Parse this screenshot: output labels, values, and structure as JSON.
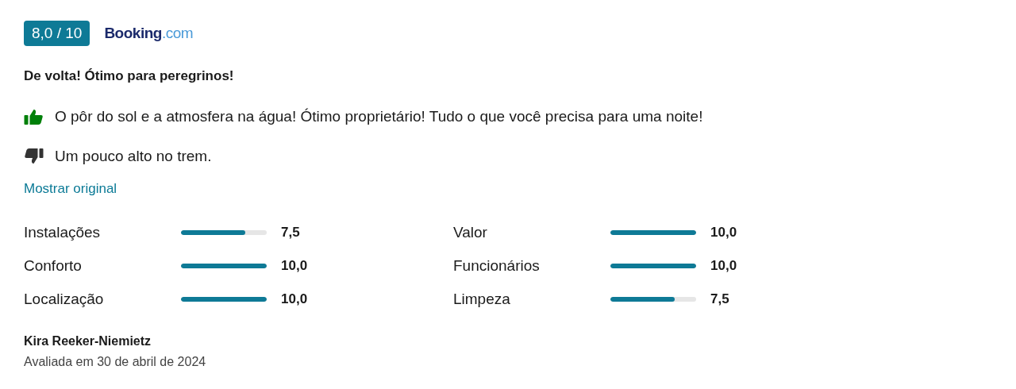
{
  "score": "8,0 / 10",
  "source": "Booking.com",
  "title": "De volta! Ótimo para peregrinos!",
  "comments": [
    {
      "kind": "positive",
      "text": "O pôr do sol e a atmosfera na água! Ótimo proprietário! Tudo o que você precisa para uma noite!"
    },
    {
      "kind": "negative",
      "text": "Um pouco alto no trem."
    }
  ],
  "link": "Mostrar original",
  "categories": [
    {
      "name": "Instalações",
      "level": 0.75,
      "reading": "7,5"
    },
    {
      "name": "Valor",
      "level": 1,
      "reading": "10,0"
    },
    {
      "name": "Conforto",
      "level": 1,
      "reading": "10,0"
    },
    {
      "name": "Funcionários",
      "level": 1,
      "reading": "10,0"
    },
    {
      "name": "Localização",
      "level": 1,
      "reading": "10,0"
    },
    {
      "name": "Limpeza",
      "level": 0.75,
      "reading": "7,5"
    }
  ],
  "reviewer": "Kira Reeker-Niemietz",
  "date": "Avaliada em 30 de abril de 2024"
}
